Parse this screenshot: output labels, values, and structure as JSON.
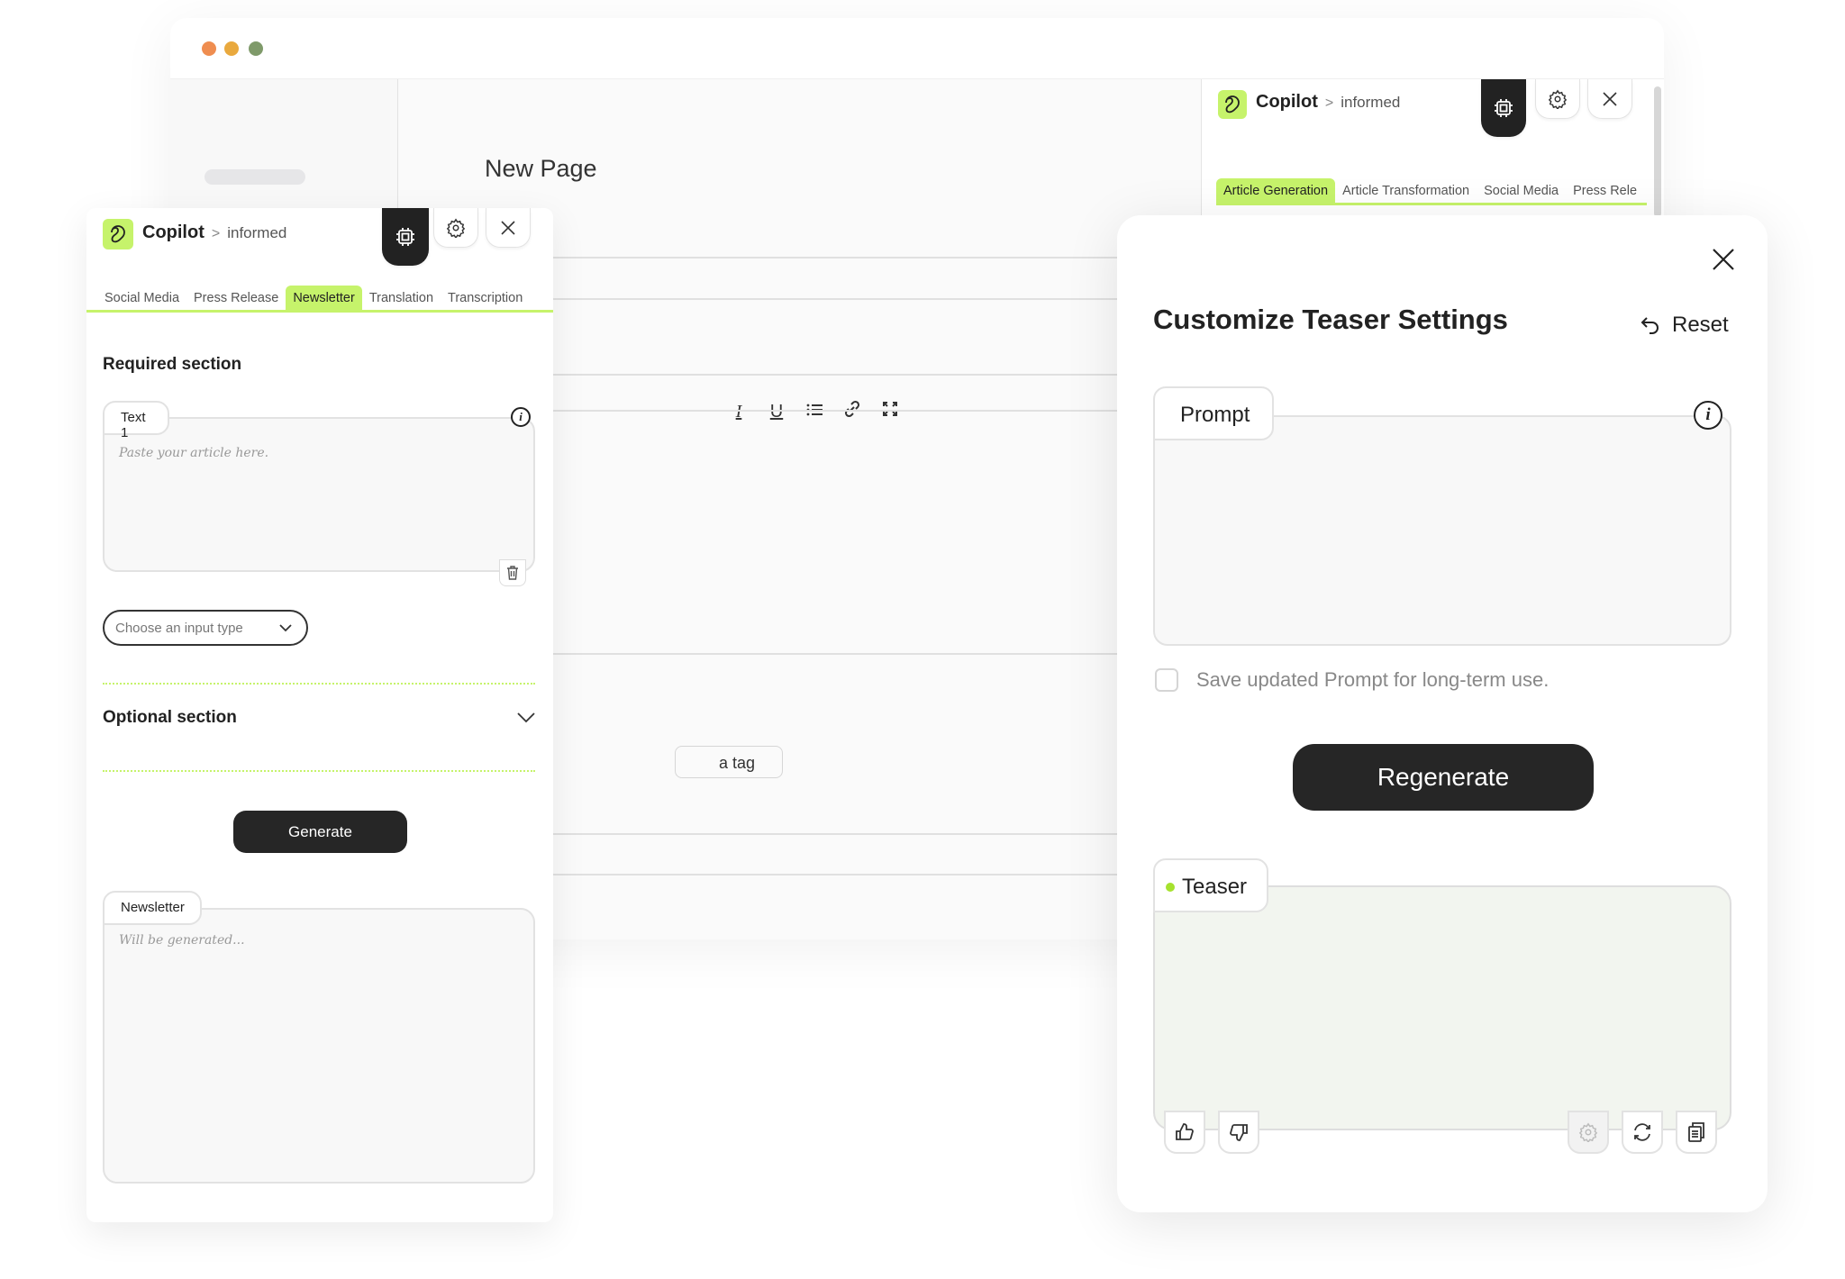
{
  "window": {
    "traffic_lights": [
      {
        "name": "close",
        "color": "#ef8d50"
      },
      {
        "name": "minimize",
        "color": "#e9a93e"
      },
      {
        "name": "maximize",
        "color": "#7f9a6a"
      }
    ],
    "page_title": "New Page",
    "editor_toolbar": [
      {
        "icon": "italic-icon",
        "glyph": "I"
      },
      {
        "icon": "underline-icon",
        "glyph": "U"
      },
      {
        "icon": "list-icon",
        "glyph": "☰"
      },
      {
        "icon": "link-icon",
        "glyph": "🔗"
      },
      {
        "icon": "expand-icon",
        "glyph": "⤢"
      }
    ],
    "tag_button_label": "a tag"
  },
  "background_copilot": {
    "title": "Copilot",
    "separator": ">",
    "subtitle": "informed",
    "tabs": [
      {
        "label": "Article Generation",
        "active": true
      },
      {
        "label": "Article Transformation",
        "active": false
      },
      {
        "label": "Social Media",
        "active": false
      },
      {
        "label": "Press Rele",
        "active": false
      }
    ]
  },
  "copilot_panel": {
    "title": "Copilot",
    "separator": ">",
    "subtitle": "informed",
    "tabs": [
      {
        "label": "Social Media",
        "active": false
      },
      {
        "label": "Press Release",
        "active": false
      },
      {
        "label": "Newsletter",
        "active": true
      },
      {
        "label": "Translation",
        "active": false
      },
      {
        "label": "Transcription",
        "active": false
      }
    ],
    "required_section_title": "Required section",
    "text_field": {
      "label": "Text 1",
      "placeholder": "Paste your article here.",
      "value": ""
    },
    "input_type_select": {
      "placeholder": "Choose an input type"
    },
    "optional_section_title": "Optional section",
    "generate_label": "Generate",
    "output_field": {
      "label": "Newsletter",
      "placeholder": "Will be generated...",
      "value": ""
    }
  },
  "modal": {
    "title": "Customize Teaser Settings",
    "reset_label": "Reset",
    "prompt_label": "Prompt",
    "prompt_value": "",
    "save_checkbox_label": "Save updated Prompt for long-term use.",
    "save_checked": false,
    "regenerate_label": "Regenerate",
    "teaser_label": "Teaser",
    "teaser_value": ""
  },
  "colors": {
    "accent": "#c6f36b",
    "dark": "#262626",
    "teaser_bg": "#f2f5ef"
  }
}
